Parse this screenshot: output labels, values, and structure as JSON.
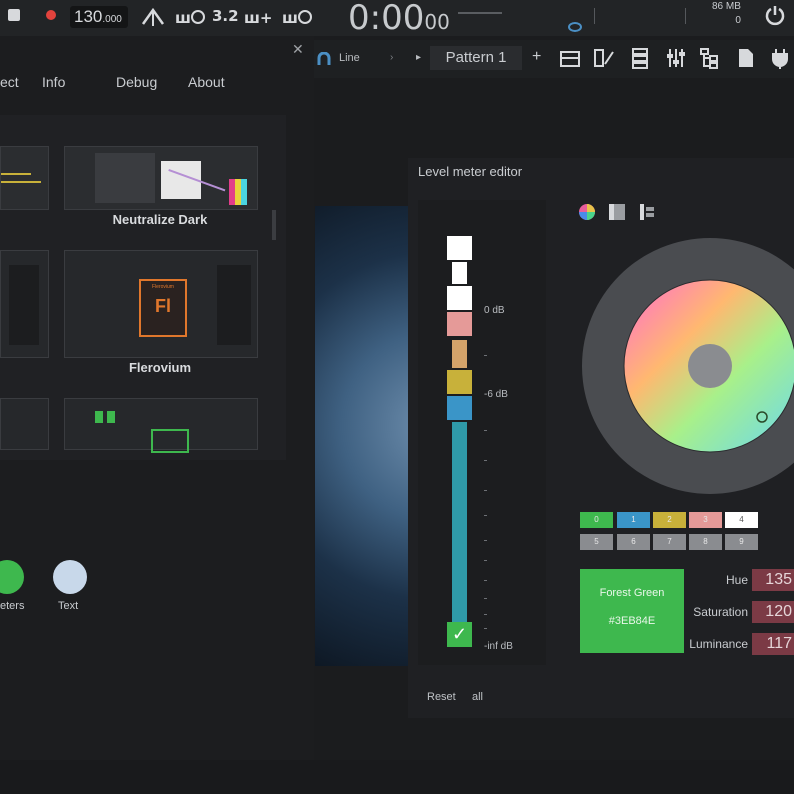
{
  "toolbar": {
    "tempo_main": "130",
    "tempo_frac": ".000",
    "pattern_num_text": "3.2",
    "clock_main": "0:00",
    "clock_sub": "00",
    "mem_text": "86 MB",
    "cpu_text": "0"
  },
  "toolbar2": {
    "snap_label": "Line",
    "pattern_label": "Pattern 1",
    "add_label": "+"
  },
  "left_panel": {
    "tabs": [
      "ect",
      "Info",
      "Debug",
      "About"
    ],
    "themes": [
      {
        "label": "Neutralize Dark"
      },
      {
        "label": "Flerovium",
        "badge_top": "Flerovium",
        "badge": "Fl"
      }
    ],
    "circles": [
      {
        "label": "eters",
        "color": "#3eb84e"
      },
      {
        "label": "Text",
        "color": "#c8d8ea"
      }
    ]
  },
  "editor": {
    "title": "Level meter editor",
    "db_labels": [
      "0 dB",
      "-6 dB",
      "-inf dB"
    ],
    "meter_segments": [
      {
        "color": "#ffffff"
      },
      {
        "color": "#ffffff"
      },
      {
        "color": "#ffffff"
      },
      {
        "color": "#e59a98"
      },
      {
        "color": "#d4a36a"
      },
      {
        "color": "#c8b13a"
      },
      {
        "color": "#3a95c8"
      },
      {
        "color": "#2f9aa8"
      }
    ],
    "swatches_row1": [
      {
        "label": "0",
        "color": "#3eb84e"
      },
      {
        "label": "1",
        "color": "#3a95c8"
      },
      {
        "label": "2",
        "color": "#c8b13a"
      },
      {
        "label": "3",
        "color": "#e59a98"
      },
      {
        "label": "4",
        "color": "#ffffff"
      }
    ],
    "swatches_row2": [
      {
        "label": "5",
        "color": "#8a8c90"
      },
      {
        "label": "6",
        "color": "#8a8c90"
      },
      {
        "label": "7",
        "color": "#8a8c90"
      },
      {
        "label": "8",
        "color": "#8a8c90"
      },
      {
        "label": "9",
        "color": "#8a8c90"
      }
    ],
    "preview_name": "Forest Green",
    "preview_hex": "#3EB84E",
    "hue_label": "Hue",
    "hue_value": "135",
    "saturation_label": "Saturation",
    "saturation_value": "120",
    "luminance_label": "Luminance",
    "luminance_value": "117",
    "reset_label": "Reset",
    "all_label": "all"
  },
  "colors": {
    "accent_green": "#3eb84e",
    "prop_value_bg": "#7b3a45"
  }
}
